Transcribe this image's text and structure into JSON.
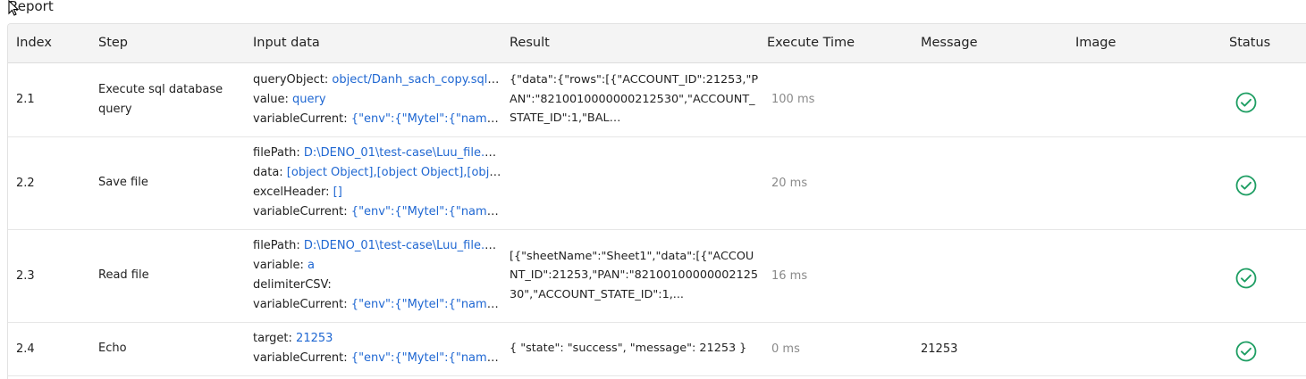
{
  "page": {
    "title": "Report"
  },
  "table": {
    "headers": [
      "Index",
      "Step",
      "Input data",
      "Result",
      "Execute Time",
      "Message",
      "Image",
      "Status"
    ],
    "rows": [
      {
        "index": "2.1",
        "step": "Execute sql database query",
        "inputs": [
          {
            "key": "queryObject: ",
            "value": "object/Danh_sach_copy.sqlobj"
          },
          {
            "key": "value: ",
            "value": "query"
          },
          {
            "key": "variableCurrent: ",
            "value": "{\"env\":{\"Mytel\":{\"name\":\" ..."
          }
        ],
        "result": "{\"data\":{\"rows\":[{\"ACCOUNT_ID\":21253,\"PAN\":\"8210010000000212530\",\"ACCOUNT_STATE_ID\":1,\"BAL…",
        "time": "100 ms",
        "message": "",
        "image": "",
        "status": "success"
      },
      {
        "index": "2.2",
        "step": "Save file",
        "inputs": [
          {
            "key": "filePath: ",
            "value": "D:\\DENO_01\\test-case\\Luu_file.xlsx"
          },
          {
            "key": "data: ",
            "value": "[object Object],[object Object],[objec..."
          },
          {
            "key": "excelHeader: ",
            "value": "[]"
          },
          {
            "key": "variableCurrent: ",
            "value": "{\"env\":{\"Mytel\":{\"name\":\" ..."
          }
        ],
        "result": "",
        "time": "20 ms",
        "message": "",
        "image": "",
        "status": "success"
      },
      {
        "index": "2.3",
        "step": "Read file",
        "inputs": [
          {
            "key": "filePath: ",
            "value": "D:\\DENO_01\\test-case\\Luu_file.xlsx"
          },
          {
            "key": "variable: ",
            "value": "a"
          },
          {
            "key": "delimiterCSV: ",
            "value": ""
          },
          {
            "key": "variableCurrent: ",
            "value": "{\"env\":{\"Mytel\":{\"name\":\" ..."
          }
        ],
        "result": "[{\"sheetName\":\"Sheet1\",\"data\":[{\"ACCOUNT_ID\":21253,\"PAN\":\"8210010000000212530\",\"ACCOUNT_STATE_ID\":1,...",
        "time": "16 ms",
        "message": "",
        "image": "",
        "status": "success"
      },
      {
        "index": "2.4",
        "step": "Echo",
        "inputs": [
          {
            "key": "target: ",
            "value": "21253"
          },
          {
            "key": "variableCurrent: ",
            "value": "{\"env\":{\"Mytel\":{\"name\":\" ..."
          }
        ],
        "result": "{ \"state\": \"success\", \"message\": 21253 }",
        "time": "0 ms",
        "message": "21253",
        "image": "",
        "status": "success"
      }
    ]
  },
  "colors": {
    "link": "#1f67d2",
    "status_ok": "#1e9e63",
    "header_bg": "#f4f4f4"
  },
  "icons": {
    "status_success": "check-circle-icon",
    "cursor": "mouse-pointer-icon"
  }
}
